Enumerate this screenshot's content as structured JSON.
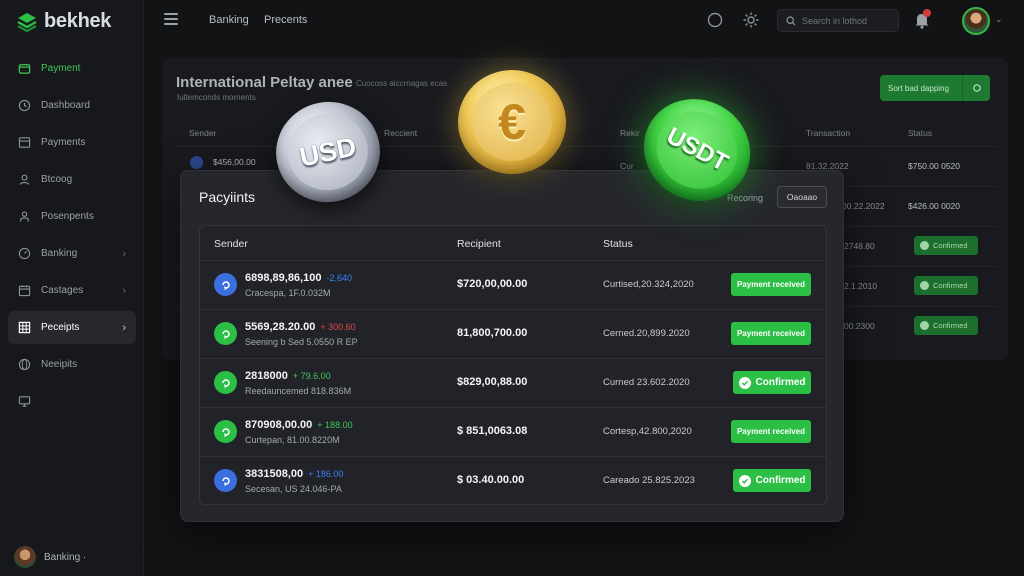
{
  "app": {
    "name": "bekhek"
  },
  "sidebar": {
    "items": [
      {
        "label": "Payment",
        "icon": "wallet-icon"
      },
      {
        "label": "Dashboard",
        "icon": "clock-icon"
      },
      {
        "label": "Payments",
        "icon": "card-icon"
      },
      {
        "label": "Btcoog",
        "icon": "user-icon"
      },
      {
        "label": "Posenpents",
        "icon": "person-icon"
      },
      {
        "label": "Banking",
        "icon": "gauge-icon"
      },
      {
        "label": "Castages",
        "icon": "calendar-icon"
      },
      {
        "label": "Peceipts",
        "icon": "grid-icon"
      },
      {
        "label": "Neeipits",
        "icon": "globe-icon"
      },
      {
        "label": "",
        "icon": "monitor-icon"
      }
    ],
    "footer_label": "Banking ·"
  },
  "topbar": {
    "links": [
      "Banking",
      "Precents"
    ],
    "search_placeholder": "Search in lothod"
  },
  "background": {
    "title": "International Peltay anee",
    "title_extra": "Cuocoss aiccrnagas ecas",
    "subtitle": "Iultemconds mornents",
    "button_label": "Sort bad dapping",
    "headers": [
      "Sender",
      "Reccient",
      "Rekir",
      "Transaction",
      "Status"
    ],
    "rows": [
      {
        "sender": "$456,00.00",
        "col3": "Cur",
        "date": "81.32.2022",
        "status": "$750.00 0520"
      },
      {
        "sender": "",
        "col3": "",
        "date": "00.22.2022",
        "status": "$426.00 0020"
      },
      {
        "sender": "",
        "col3": "",
        "date": "2748.80",
        "status": "Confirmed"
      },
      {
        "sender": "",
        "col3": "",
        "date": "2.1.2010",
        "status": "Confirmed"
      },
      {
        "sender": "",
        "col3": "",
        "date": "00.2300",
        "status": "Confirmed"
      }
    ]
  },
  "coins": {
    "usd": "USD",
    "eur": "€",
    "usdt": "USDT"
  },
  "modal": {
    "title": "Pacyiints",
    "side_label": "Recoring",
    "button_label": "Oaoaao",
    "headers": {
      "sender": "Sender",
      "recipient": "Recipient",
      "status": "Status"
    },
    "rows": [
      {
        "amount": "6898,89,86,100",
        "delta": "-2.640",
        "delta_color": "#3b82f6",
        "sub": "Cracespa, 1F.0.032M",
        "recipient": "$720,00,00.00",
        "date": "Curtised,20.324,2020",
        "badge": "Payment received",
        "badge_type": "received",
        "icon_color": "#3b6fe0"
      },
      {
        "amount": "5569,28.20.00",
        "delta": "+ 300.60",
        "delta_color": "#e24a4a",
        "sub": "Seening b Sed 5.0550 R EP",
        "recipient": "81,800,700.00",
        "date": "Cerned.20,899.2020",
        "badge": "Payment received",
        "badge_type": "received",
        "icon_color": "#2bbf45"
      },
      {
        "amount": "2818000",
        "delta": "+ 79.6.00",
        "delta_color": "#3ec95a",
        "sub": "Reedauncemed 818.836M",
        "recipient": "$829,00,88.00",
        "date": "Curned 23.602.2020",
        "badge": "Confirmed",
        "badge_type": "confirmed",
        "icon_color": "#2bbf45"
      },
      {
        "amount": "870908,00.00",
        "delta": "+ 188.00",
        "delta_color": "#3ec95a",
        "sub": "Curtepan, 81.00.8220M",
        "recipient": "$ 851,0063.08",
        "date": "Cortesp,42.800,2020",
        "badge": "Payment received",
        "badge_type": "received",
        "icon_color": "#2bbf45"
      },
      {
        "amount": "3831508,00",
        "delta": "+ 186.00",
        "delta_color": "#3b82f6",
        "sub": "Secesan, US 24.046-PA",
        "recipient": "$ 03.40.00.00",
        "date": "Careado 25.825.2023",
        "badge": "Confirmed",
        "badge_type": "confirmed",
        "icon_color": "#3b6fe0"
      }
    ]
  },
  "colors": {
    "accent": "#2bbf45",
    "background": "#121315",
    "panel": "#26272d"
  }
}
